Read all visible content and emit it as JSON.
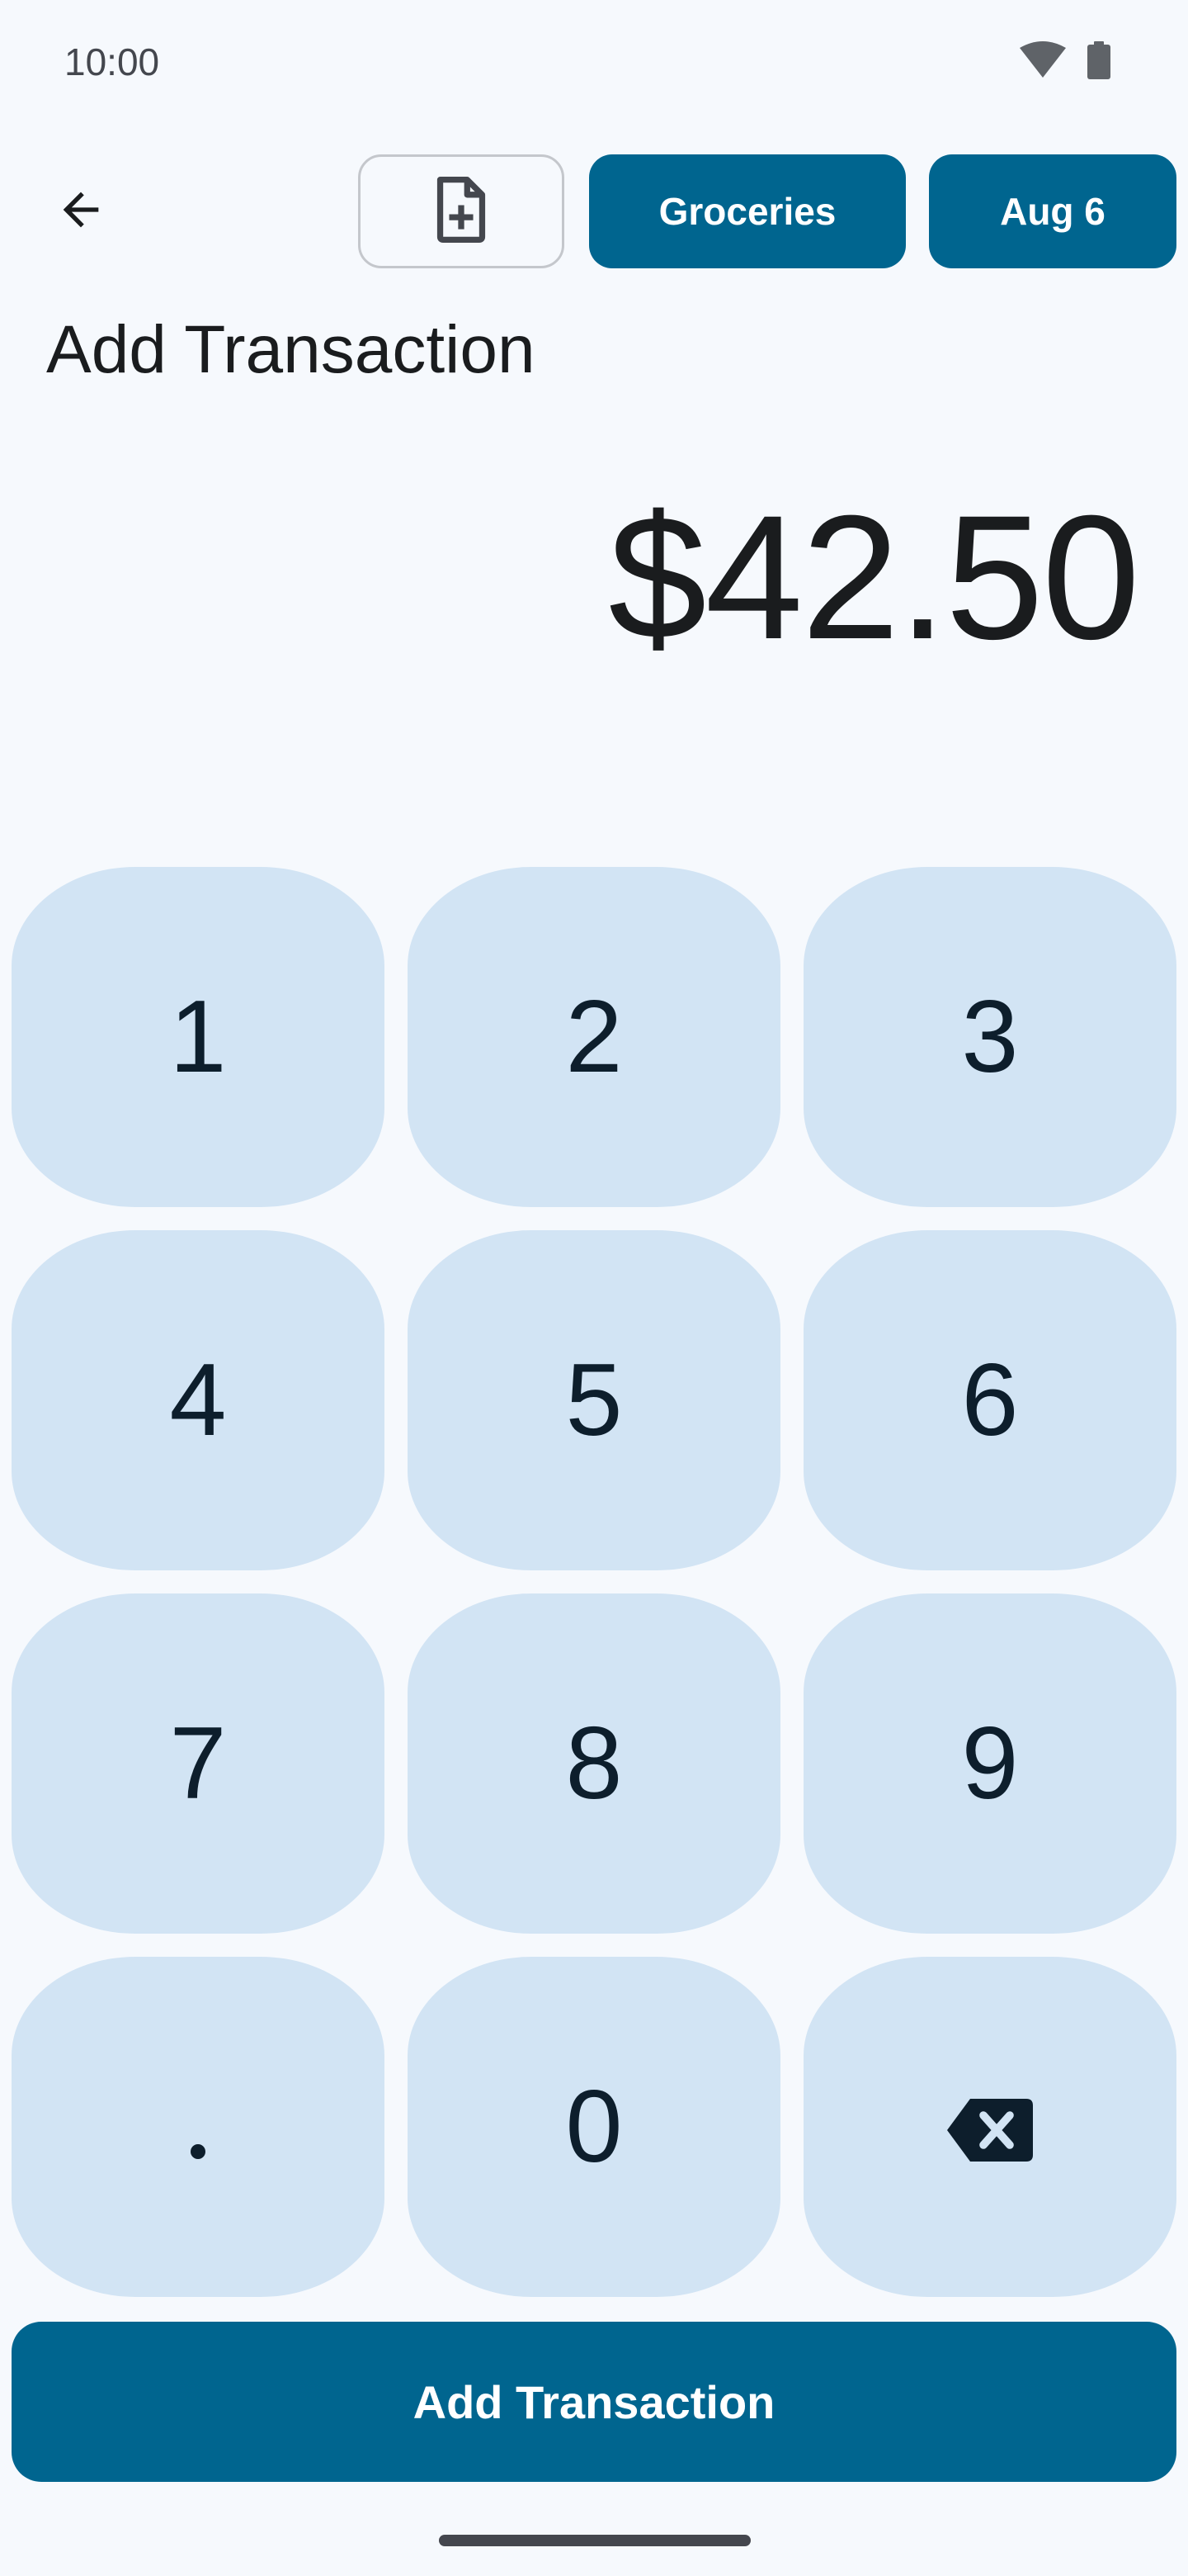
{
  "status_bar": {
    "time": "10:00",
    "icons": [
      "wifi-icon",
      "battery-icon"
    ]
  },
  "toolbar": {
    "back_icon": "arrow-back-icon",
    "attach_icon": "note-add-icon",
    "category": "Groceries",
    "date": "Aug 6"
  },
  "page": {
    "title": "Add Transaction",
    "amount": "$42.50"
  },
  "keypad": {
    "keys": [
      "1",
      "2",
      "3",
      "4",
      "5",
      "6",
      "7",
      "8",
      "9",
      ".",
      "0",
      "backspace-icon"
    ]
  },
  "submit": {
    "label": "Add Transaction"
  },
  "colors": {
    "background": "#f6f9fd",
    "primary": "#00658f",
    "key_background": "#d2e4f4",
    "key_text": "#0d1e2c"
  }
}
